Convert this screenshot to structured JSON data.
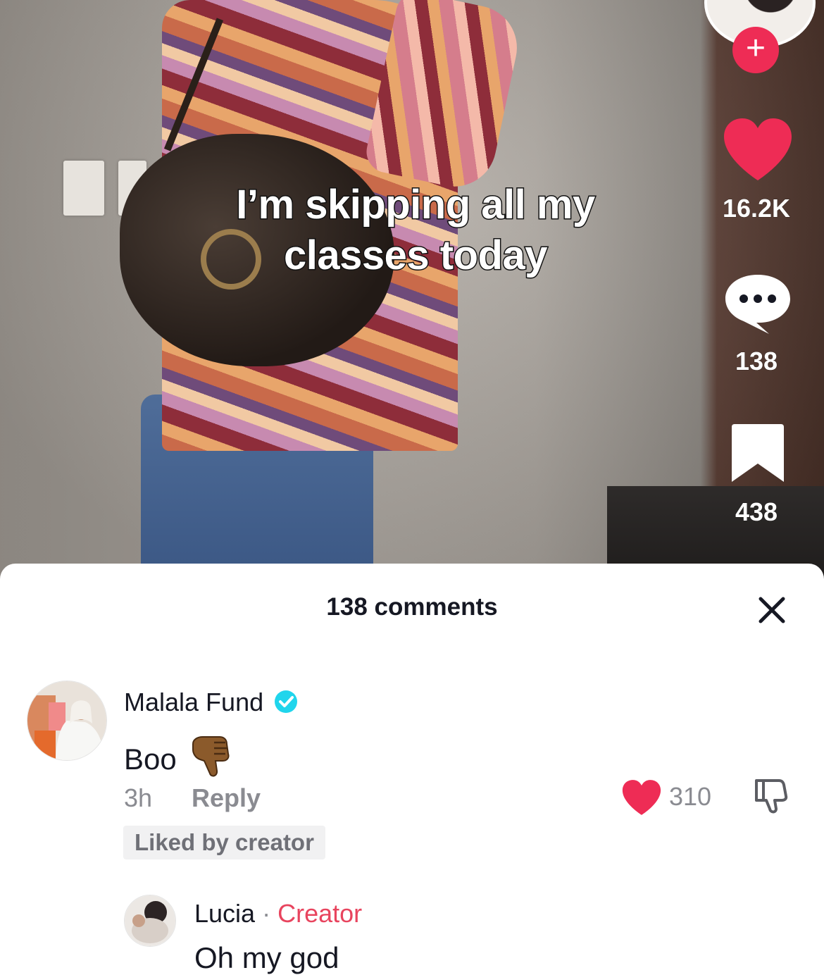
{
  "video": {
    "caption_line1": "I’m skipping all my",
    "caption_line2": "classes today"
  },
  "rail": {
    "follow_symbol": "+",
    "likes": "16.2K",
    "comments": "138",
    "saves": "438",
    "like_color": "#ee2c55"
  },
  "comments_sheet": {
    "title": "138 comments",
    "close_icon": "close-icon",
    "comments": [
      {
        "author": "Malala Fund",
        "verified": true,
        "text": "Boo",
        "emoji": "thumbs-down",
        "time": "3h",
        "reply_label": "Reply",
        "badge": "Liked by creator",
        "like_count": "310"
      },
      {
        "author": "Lucia",
        "separator": "·",
        "role": "Creator",
        "text": "Oh my god"
      }
    ]
  },
  "colors": {
    "accent_red": "#ee2c55",
    "verified_blue": "#20d5ec",
    "creator_pink": "#e8445e"
  }
}
